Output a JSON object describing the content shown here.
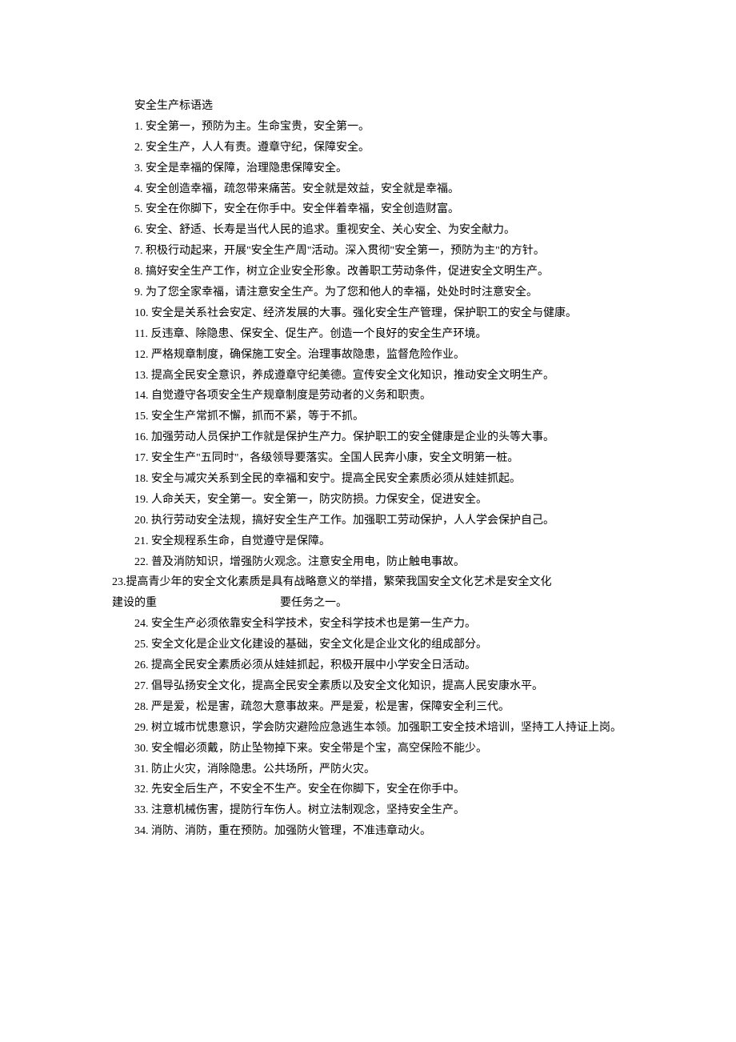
{
  "title": "安全生产标语选",
  "items": [
    "1. 安全第一，预防为主。生命宝贵，安全第一。",
    "2. 安全生产，人人有责。遵章守纪，保障安全。",
    "3. 安全是幸福的保障，治理隐患保障安全。",
    "4. 安全创造幸福，疏忽带来痛苦。安全就是效益，安全就是幸福。",
    "5. 安全在你脚下，安全在你手中。安全伴着幸福，安全创造财富。",
    "6. 安全、舒适、长寿是当代人民的追求。重视安全、关心安全、为安全献力。",
    "7. 积极行动起来，开展\"安全生产周\"活动。深入贯彻\"安全第一，预防为主\"的方针。",
    "8. 搞好安全生产工作，树立企业安全形象。改善职工劳动条件，促进安全文明生产。",
    "9. 为了您全家幸福，请注意安全生产。为了您和他人的幸福，处处时时注意安全。",
    "10. 安全是关系社会安定、经济发展的大事。强化安全生产管理，保护职工的安全与健康。",
    "11. 反违章、除隐患、保安全、促生产。创造一个良好的安全生产环境。",
    "12. 严格规章制度，确保施工安全。治理事故隐患，监督危险作业。",
    "13. 提高全民安全意识，养成遵章守纪美德。宣传安全文化知识，推动安全文明生产。",
    "14. 自觉遵守各项安全生产规章制度是劳动者的义务和职责。",
    "15. 安全生产常抓不懈，抓而不紧，等于不抓。",
    "16. 加强劳动人员保护工作就是保护生产力。保护职工的安全健康是企业的头等大事。",
    "17. 安全生产\"五同时\"，各级领导要落实。全国人民奔小康，安全文明第一桩。",
    "18. 安全与减灾关系到全民的幸福和安宁。提高全民安全素质必须从娃娃抓起。",
    "19. 人命关天，安全第一。安全第一，防灾防损。力保安全，促进安全。",
    "20. 执行劳动安全法规，搞好安全生产工作。加强职工劳动保护，人人学会保护自己。",
    "21. 安全规程系生命，自觉遵守是保障。",
    "22. 普及消防知识，增强防火观念。注意安全用电，防止触电事故。"
  ],
  "item23": {
    "line1": "23.提高青少年的安全文化素质是具有战略意义的举措，繁荣我国安全文化艺术是安全文化",
    "line2_prefix": "建设的重",
    "line2_suffix": "要任务之一。"
  },
  "items_after": [
    "24. 安全生产必须依靠安全科学技术，安全科学技术也是第一生产力。",
    "25. 安全文化是企业文化建设的基础，安全文化是企业文化的组成部分。",
    "26. 提高全民安全素质必须从娃娃抓起，积极开展中小学安全日活动。",
    "27. 倡导弘扬安全文化，提高全民安全素质以及安全文化知识，提高人民安康水平。",
    "28. 严是爱，松是害，疏忽大意事故来。严是爱，松是害，保障安全利三代。",
    "29. 树立城市忧患意识，学会防灾避险应急逃生本领。加强职工安全技术培训，坚持工人持证上岗。",
    "30. 安全帽必须戴，防止坠物掉下来。安全带是个宝，高空保险不能少。",
    "31. 防止火灾，消除隐患。公共场所，严防火灾。",
    "32. 先安全后生产，不安全不生产。安全在你脚下，安全在你手中。",
    "33. 注意机械伤害，提防行车伤人。树立法制观念，坚持安全生产。",
    "34. 消防、消防，重在预防。加强防火管理，不准违章动火。"
  ]
}
